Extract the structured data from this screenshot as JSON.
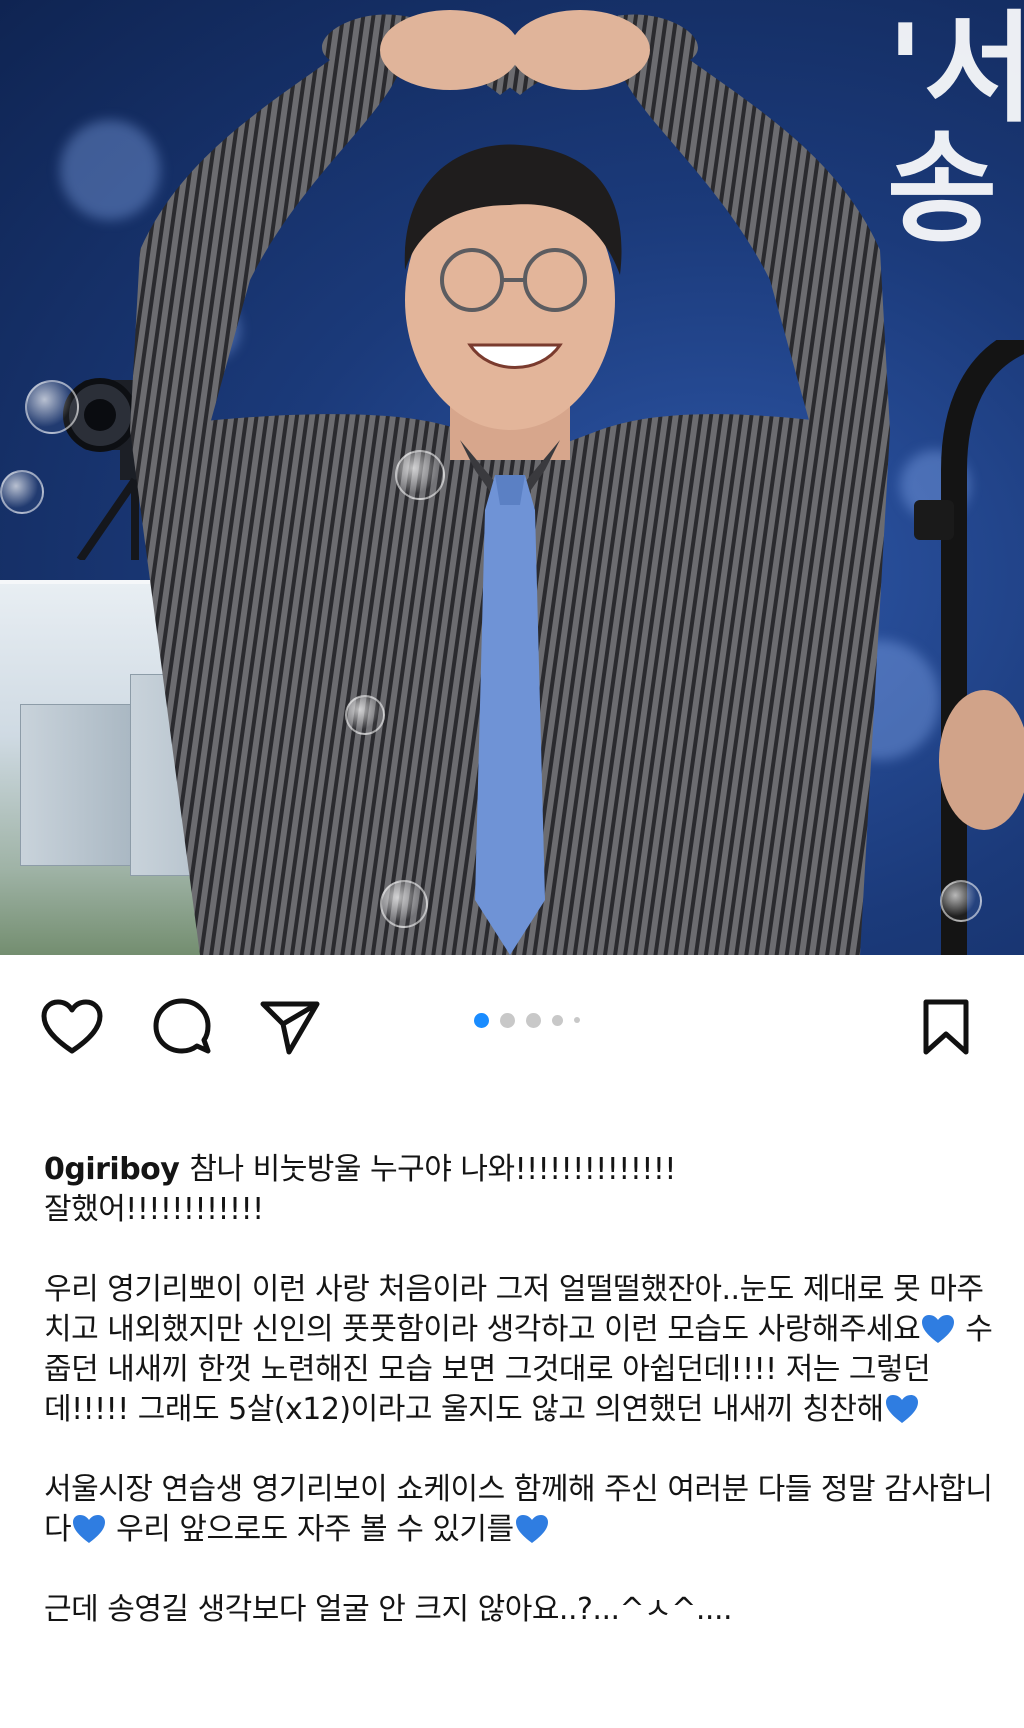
{
  "post": {
    "username": "0giriboy",
    "caption_line1": "참나 비눗방울 누구야 나와!!!!!!!!!!!!!!",
    "caption_line2": "잘했어!!!!!!!!!!!!",
    "para2_a": "우리 영기리뽀이 이런 사랑 처음이라 그저 얼떨떨했잔아..눈도 제대로 못 마주치고 내외했지만 신인의 풋풋함이라 생각하고 이런 모습도 사랑해주세요",
    "para2_b": " 수줍던 내새끼 한껏 노련해진 모습 보면 그것대로 아쉽던데!!!! 저는 그렇던데!!!!! 그래도 5살(x12)이라고 울지도 않고 의연했던 내새끼 칭찬해",
    "para3_a": "서울시장 연습생 영기리보이 쇼케이스 함께해 주신 여러분 다들 정말 감사합니다",
    "para3_b": " 우리 앞으로도 자주 볼 수 있기를",
    "para4": "근데 송영길 생각보다 얼굴 안 크지 않아요..?...^ㅅ^...."
  },
  "photo": {
    "background_text": "'서\n송"
  },
  "carousel": {
    "total": 5,
    "active_index": 0
  },
  "icons": {
    "like": "heart-outline-icon",
    "comment": "speech-bubble-icon",
    "share": "paper-plane-icon",
    "save": "bookmark-icon",
    "inline_emoji": "blue-heart-icon"
  },
  "colors": {
    "accent": "#1a8cff",
    "blue_heart": "#2f7de1",
    "text": "#141414"
  }
}
